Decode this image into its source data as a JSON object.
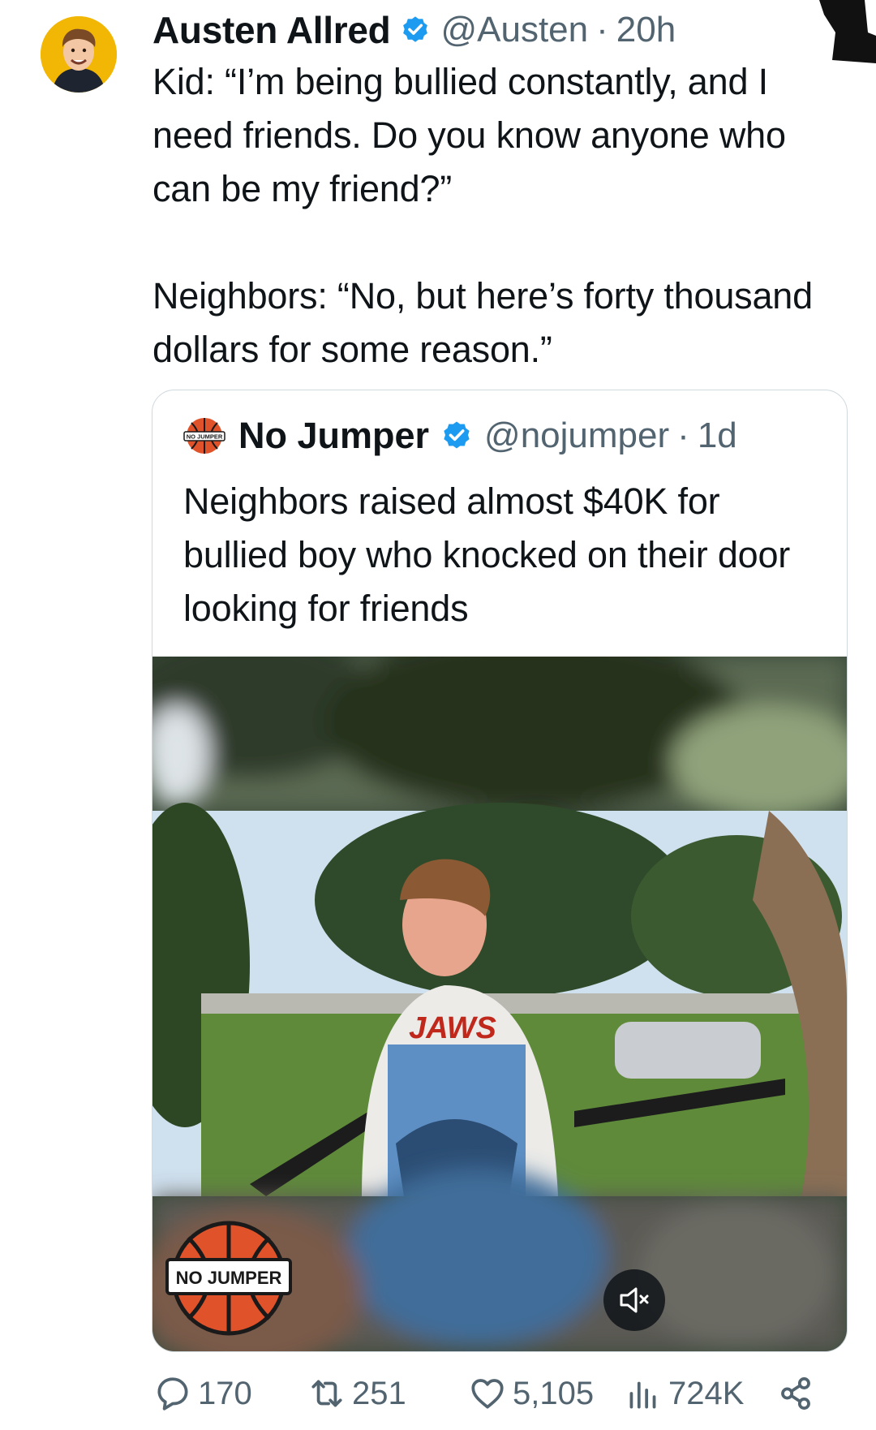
{
  "tweet": {
    "author_name": "Austen Allred",
    "handle": "@Austen",
    "separator": "·",
    "time": "20h",
    "text": "Kid: “I’m being bullied constantly, and I need friends. Do you know anyone who can be my friend?”\n\nNeighbors: “No, but here’s forty thousand dollars for some reason.”",
    "verified_color": "#1d9bf0",
    "avatar_bg": "#f2b705"
  },
  "quote": {
    "author_name": "No Jumper",
    "handle": "@nojumper",
    "separator": "·",
    "time": "1d",
    "text": "Neighbors raised almost $40K for bullied boy who knocked on their door looking for friends",
    "avatar_logo_text": "NO JUMPER",
    "media": {
      "shirt_text": "JAWS",
      "watermark_text": "NO JUMPER",
      "mute_icon": "speaker-muted-icon"
    }
  },
  "actions": {
    "replies": "170",
    "reposts": "251",
    "likes": "5,105",
    "views": "724K"
  },
  "colors": {
    "text_primary": "#0f1419",
    "text_secondary": "#536471",
    "border": "#cfd9de"
  }
}
